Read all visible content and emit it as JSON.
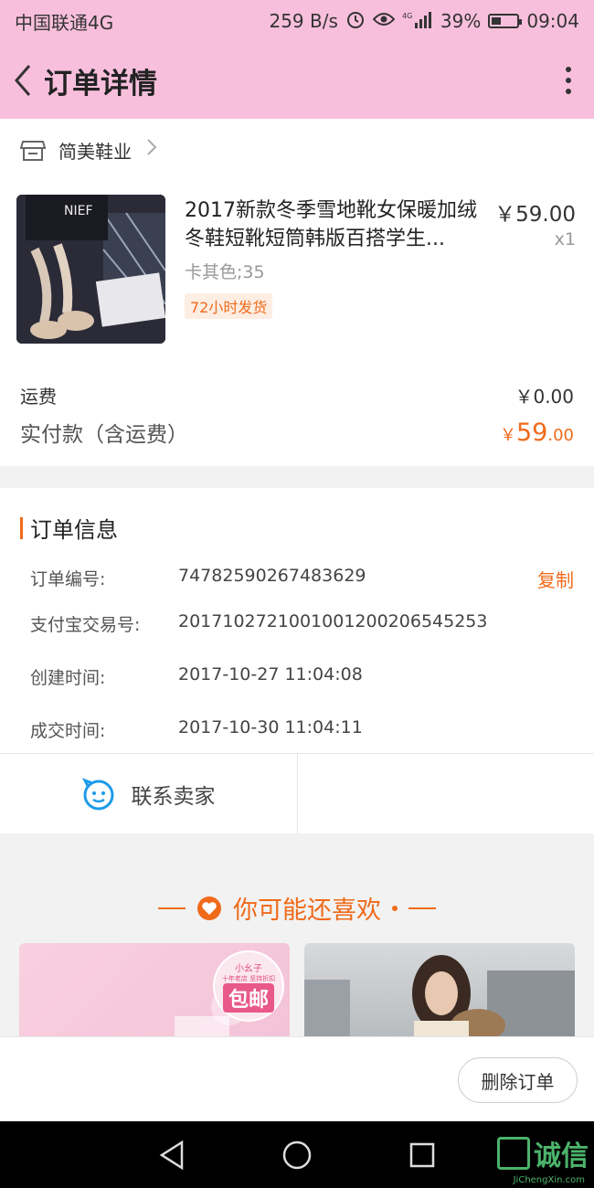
{
  "status": {
    "carrier": "中国联通4G",
    "speed": "259 B/s",
    "network": "4G",
    "battery": "39%",
    "time": "09:04"
  },
  "header": {
    "title": "订单详情"
  },
  "shop": {
    "name": "简美鞋业"
  },
  "product": {
    "title": "2017新款冬季雪地靴女保暖加绒冬鞋短靴短筒韩版百搭学生...",
    "price": "￥59.00",
    "quantity": "x1",
    "sku": "卡其色;35",
    "tag": "72小时发货",
    "image_text": "NIEF"
  },
  "fees": {
    "shipping_label": "运费",
    "shipping_value": "￥0.00",
    "paid_label": "实付款（含运费）",
    "paid_currency": "￥",
    "paid_integer": "59",
    "paid_decimal": ".00"
  },
  "order_info": {
    "title": "订单信息",
    "rows": [
      {
        "label": "订单编号:",
        "value": "74782590267483629"
      },
      {
        "label": "支付宝交易号:",
        "value": "2017102721001001200206545253"
      },
      {
        "label": "创建时间:",
        "value": "2017-10-27 11:04:08"
      },
      {
        "label": "成交时间:",
        "value": "2017-10-30 11:04:11"
      }
    ],
    "copy_label": "复制",
    "contact_label": "联系卖家"
  },
  "recommend": {
    "title": "你可能还喜欢",
    "badge_small": "小幺子",
    "badge_line2": "十年老店 坚持折扣",
    "badge_big": "包邮"
  },
  "footer": {
    "delete_label": "删除订单"
  },
  "watermark": {
    "text": "诚信",
    "sub": "JiChengXin.com"
  },
  "colors": {
    "accent": "#f06a1a",
    "header_bg": "#f8bfdc"
  }
}
